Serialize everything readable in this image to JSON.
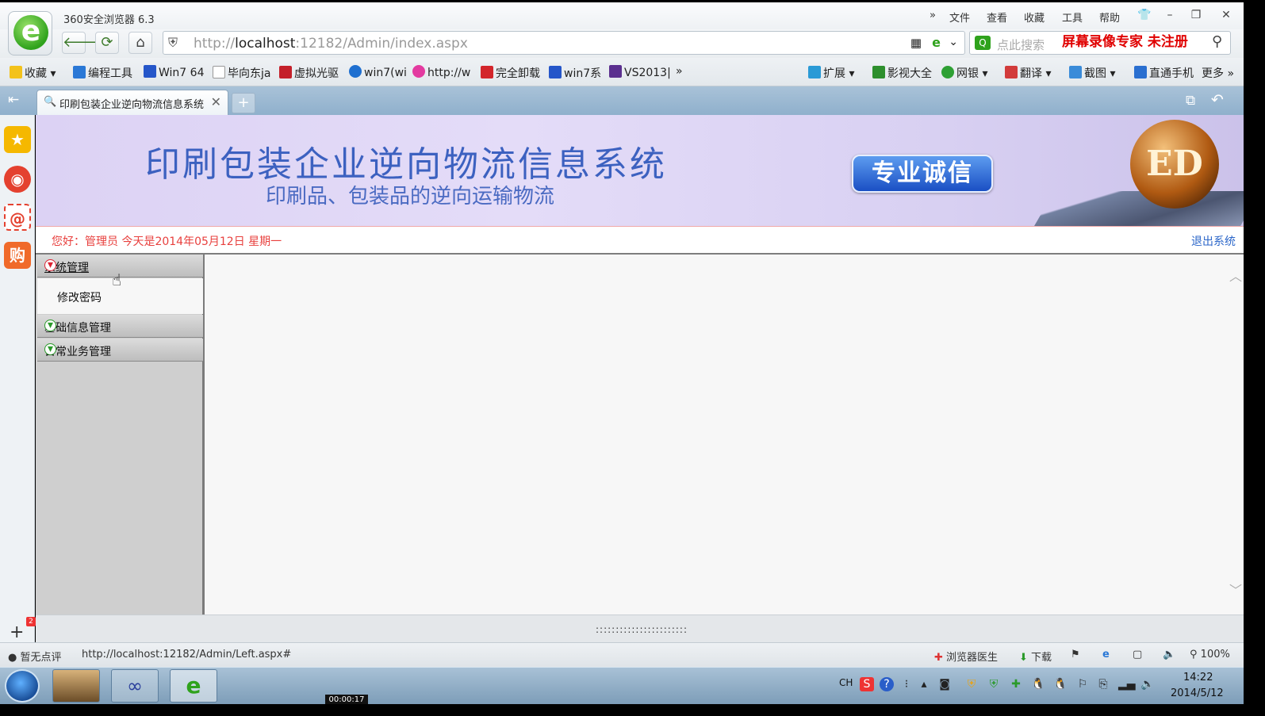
{
  "browser": {
    "title": "360安全浏览器 6.3",
    "menu": [
      "文件",
      "查看",
      "收藏",
      "工具",
      "帮助"
    ],
    "menu_more": "»",
    "url_prefix": "http://",
    "url_host": "localhost",
    "url_rest": ":12182/Admin/index.aspx",
    "search_placeholder": "点此搜索",
    "recorder_watermark": "屏幕录像专家  未注册"
  },
  "bookmarks": [
    {
      "label": "收藏",
      "icon": "star-icon"
    },
    {
      "label": "编程工具",
      "icon": "folder-icon"
    },
    {
      "label": "Win7 64",
      "icon": "paw-icon"
    },
    {
      "label": "毕向东ja",
      "icon": "page-icon"
    },
    {
      "label": "虚拟光驱",
      "icon": "x-icon"
    },
    {
      "label": "win7(wi",
      "icon": "globe-icon"
    },
    {
      "label": "http://w",
      "icon": "heart-icon"
    },
    {
      "label": "完全卸载",
      "icon": "paw-icon"
    },
    {
      "label": "win7系",
      "icon": "paw-icon"
    },
    {
      "label": "VS2013|",
      "icon": "vs-icon"
    }
  ],
  "bookmarks_more": "»",
  "toolbar_right": [
    "扩展",
    "影视大全",
    "网银",
    "翻译",
    "截图",
    "直通手机",
    "更多"
  ],
  "tab": {
    "label": "印刷包装企业逆向物流信息系统"
  },
  "banner": {
    "title": "印刷包装企业逆向物流信息系统",
    "subtitle": "印刷品、包装品的逆向运输物流",
    "badge": "专业诚信",
    "logo_text": "ED"
  },
  "infobar": {
    "greeting": "您好：管理员   今天是2014年05月12日   星期一",
    "logout": "退出系统"
  },
  "left_menu": {
    "groups": [
      {
        "label": "系统管理",
        "expanded": true,
        "items": [
          "修改密码"
        ]
      },
      {
        "label": "基础信息管理",
        "expanded": false
      },
      {
        "label": "日常业务管理",
        "expanded": false
      }
    ]
  },
  "status": {
    "rating": "暂无点评",
    "url": "http://localhost:12182/Admin/Left.aspx#",
    "doctor": "浏览器医生",
    "download": "下载",
    "zoom": "100%"
  },
  "taskbar": {
    "lang": "CH",
    "time": "14:22",
    "date": "2014/5/12"
  },
  "recorder_time": "00:00:17",
  "colors": {
    "greeting": "#e8403e",
    "logout": "#2b66c9",
    "banner_title": "#3c61c0",
    "watermark": "#e00000"
  }
}
